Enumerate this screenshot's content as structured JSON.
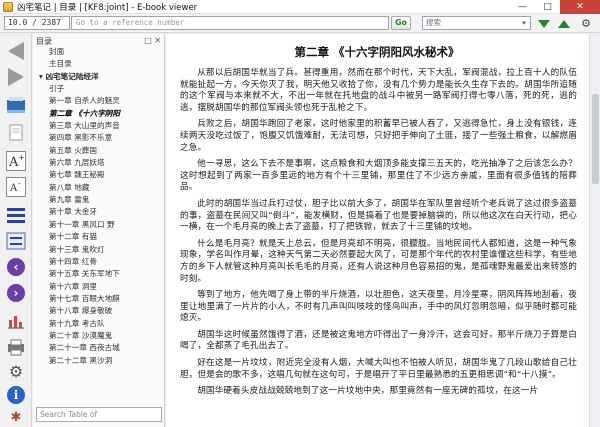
{
  "window": {
    "title": "凶宅笔记 | 目录 | [KF8:joint] - E-book viewer"
  },
  "toolbar": {
    "position": "10.0 / 2387",
    "reference_placeholder": "Go to a reference number",
    "go_label": "Go",
    "search_placeholder": "搜索"
  },
  "icons": {
    "back": "arrow-left-icon",
    "forward": "arrow-right-icon",
    "next": "next-icon",
    "previous": "previous-icon",
    "settings": "gear-icon",
    "info": "info-icon"
  },
  "colors": {
    "accent_green": "#1f8a2c",
    "close_red": "#c8413a"
  },
  "sidebar": {
    "header": "目录",
    "toc": [
      {
        "label": "封面",
        "indent": 1
      },
      {
        "label": "主目录",
        "indent": 1
      },
      {
        "label": "凶宅笔记陆经洋",
        "indent": 0,
        "section": true
      },
      {
        "label": "引子",
        "indent": 1
      },
      {
        "label": "第一章 自杀人的魅灵",
        "indent": 1
      },
      {
        "label": "第二章 《十六字阴阳",
        "indent": 1,
        "current": true
      },
      {
        "label": "第三章 大山里的声音",
        "indent": 1
      },
      {
        "label": "第四章 黑影不乐意",
        "indent": 1
      },
      {
        "label": "第五章 火葬国",
        "indent": 1
      },
      {
        "label": "第六章 九层妖塔",
        "indent": 1
      },
      {
        "label": "第七章 魏王秘殿",
        "indent": 1
      },
      {
        "label": "第八章 地藏",
        "indent": 1
      },
      {
        "label": "第九章 雷鬼",
        "indent": 1
      },
      {
        "label": "第十章 大金牙",
        "indent": 1
      },
      {
        "label": "第十一章 黑风口 野",
        "indent": 1
      },
      {
        "label": "第十二章 有猫",
        "indent": 1
      },
      {
        "label": "第十三章 鬼吹灯",
        "indent": 1
      },
      {
        "label": "第十四章 红骨",
        "indent": 1
      },
      {
        "label": "第十五章 关东军地下",
        "indent": 1
      },
      {
        "label": "第十六章 洞里",
        "indent": 1
      },
      {
        "label": "第十七章 百眼大地麒",
        "indent": 1
      },
      {
        "label": "第十八章 爆身敬破",
        "indent": 1
      },
      {
        "label": "第十九章 考古队",
        "indent": 1
      },
      {
        "label": "第二十章 沙漠魔鬼",
        "indent": 1
      },
      {
        "label": "第二十一章 西夜古城",
        "indent": 1
      },
      {
        "label": "第二十二章 黑沙洞",
        "indent": 1
      }
    ],
    "search_placeholder": "Search Table of"
  },
  "reader": {
    "chapter_title": "第二章 《十六字阴阳风水秘术》",
    "paragraphs": [
      "从那以后胡国华就当了兵。甚得重用，然而在那个时代，天下大乱，军阀混战，拉上百十人的队伍就能扯起一方，今天你灭了我，明天他又收拾了你，没有几个势力是能长久生存下去的。胡国华所追随的这个军阀与本来就不大，不出一年就在托地盘的战斗中被另一路军阀打得七零八落，死的死，逃的逃，摆脱胡国华的那位军阀头领也死于乱枪之下。",
      "兵败之后，胡国华跑回了老家，这时他家里的积蓄早已被人吞了，又逃得急忙，身上没有银钱，连续两天没吃过饭了，饱腹又饥饿难耐，无法可想，只好把手伸向了土匪，接了一些强土粮食，以解燃眉之急。",
      "他一寻思，这么下去不是事啊，这点粮食和大烟顶多能支撑三五天的，吃光抽净了之后该怎么办？这时想起到了两家一百多里远的地方有个十三里铺，那里住了不少远方亲戚，里面有很多值钱的陪葬品。",
      "此时的胡国华当过兵打过仗，胆子比以前大多了，胡国华在军队里曾经听个老兵说了这过很多盗墓的事，盗墓在民间又叫“倒斗”，能发横财，但是搞着了也是要掉脑袋的，所以他这次在白天行动，把心一横，在一个毛月亮的晚上去了盗墓，打了把铁锨，就去了十三里铺的坟地。",
      "什么是毛月亮？就是天上总云，但是月亮却不明亮，很朦胧。当地民间代人都知道，这是一种气象现象，学名叫作月晕，这种天气第二天必然要起大风了，可是那个年代的农村里谁懂这些科学，有些地方的乡下人就管这种月亮叫长毛毛的月亮，还有人说这种月色容易招的鬼，是孤魂野鬼最爱出来转悠的时刻。",
      "等到了地方，他先喝了身上带的半斤烧酒，以壮胆色，这天夜里，月冷星寒，阴风阵阵地刮着，夜里让地里满了一片片的小人，不时有几声叫叫吱吱的怪鸟叫声，手中的风灯忽明忽暗，似乎随时都可能熄灭。",
      "胡国华这时候虽然饿得了酒，还是被这鬼地方吓得出了一身冷汗，这会可好，那半斤烧刀子算是白喝了，全都蒸了毛孔出去了。",
      "好在这是一片坟坟，附近完全没有人烟，大喊大叫也不怕被人听见，胡国华鬼了几段山歌给自己壮胆，但是会的歌不多，这唱几句就在这句可，于是唱开了平日里最熟悉的五更相思调“和“十八摸”。",
      "胡国华硬着头皮战战兢兢地到了这一片坟地中央，那里竟然有一座无碑的孤坟，在这一片"
    ]
  }
}
